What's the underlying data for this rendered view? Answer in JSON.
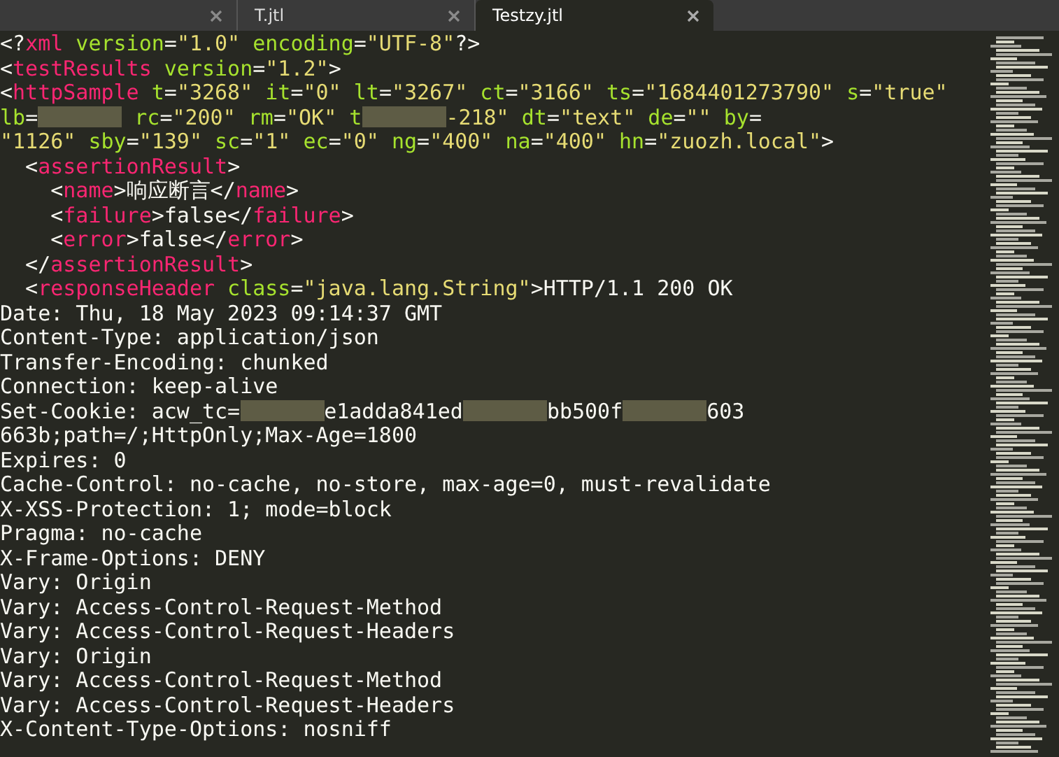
{
  "tabs": [
    {
      "selected": false
    },
    {
      "label": "T.jtl",
      "selected": false
    },
    {
      "label": "Testzy.jtl",
      "selected": true
    }
  ],
  "editor": {
    "lines": [
      [
        {
          "kind": "punct",
          "text": "<?"
        },
        {
          "kind": "tag",
          "text": "xml"
        },
        {
          "kind": "attr",
          "text": " version"
        },
        {
          "kind": "punct",
          "text": "="
        },
        {
          "kind": "string",
          "text": "\"1.0\""
        },
        {
          "kind": "attr",
          "text": " encoding"
        },
        {
          "kind": "punct",
          "text": "="
        },
        {
          "kind": "string",
          "text": "\"UTF-8\""
        },
        {
          "kind": "punct",
          "text": "?>"
        }
      ],
      [
        {
          "kind": "punct",
          "text": "<"
        },
        {
          "kind": "tag",
          "text": "testResults"
        },
        {
          "kind": "attr",
          "text": " version"
        },
        {
          "kind": "punct",
          "text": "="
        },
        {
          "kind": "string",
          "text": "\"1.2\""
        },
        {
          "kind": "punct",
          "text": ">"
        }
      ],
      [
        {
          "kind": "punct",
          "text": "<"
        },
        {
          "kind": "tag",
          "text": "httpSample"
        },
        {
          "kind": "attr",
          "text": " t"
        },
        {
          "kind": "punct",
          "text": "="
        },
        {
          "kind": "string",
          "text": "\"3268\""
        },
        {
          "kind": "attr",
          "text": " it"
        },
        {
          "kind": "punct",
          "text": "="
        },
        {
          "kind": "string",
          "text": "\"0\""
        },
        {
          "kind": "attr",
          "text": " lt"
        },
        {
          "kind": "punct",
          "text": "="
        },
        {
          "kind": "string",
          "text": "\"3267\""
        },
        {
          "kind": "attr",
          "text": " ct"
        },
        {
          "kind": "punct",
          "text": "="
        },
        {
          "kind": "string",
          "text": "\"3166\""
        },
        {
          "kind": "attr",
          "text": " ts"
        },
        {
          "kind": "punct",
          "text": "="
        },
        {
          "kind": "string",
          "text": "\"1684401273790\""
        },
        {
          "kind": "attr",
          "text": " s"
        },
        {
          "kind": "punct",
          "text": "="
        },
        {
          "kind": "string",
          "text": "\"true\""
        }
      ],
      [
        {
          "kind": "attr",
          "text": "lb"
        },
        {
          "kind": "punct",
          "text": "="
        },
        {
          "kind": "redacted"
        },
        {
          "kind": "attr",
          "text": " rc"
        },
        {
          "kind": "punct",
          "text": "="
        },
        {
          "kind": "string",
          "text": "\"200\""
        },
        {
          "kind": "attr",
          "text": " rm"
        },
        {
          "kind": "punct",
          "text": "="
        },
        {
          "kind": "string",
          "text": "\"OK\""
        },
        {
          "kind": "attr",
          "text": " t"
        },
        {
          "kind": "redacted"
        },
        {
          "kind": "string",
          "text": "-218\""
        },
        {
          "kind": "attr",
          "text": " dt"
        },
        {
          "kind": "punct",
          "text": "="
        },
        {
          "kind": "string",
          "text": "\"text\""
        },
        {
          "kind": "attr",
          "text": " de"
        },
        {
          "kind": "punct",
          "text": "="
        },
        {
          "kind": "string",
          "text": "\"\""
        },
        {
          "kind": "attr",
          "text": " by"
        },
        {
          "kind": "punct",
          "text": "="
        }
      ],
      [
        {
          "kind": "string",
          "text": "\"1126\""
        },
        {
          "kind": "attr",
          "text": " sby"
        },
        {
          "kind": "punct",
          "text": "="
        },
        {
          "kind": "string",
          "text": "\"139\""
        },
        {
          "kind": "attr",
          "text": " sc"
        },
        {
          "kind": "punct",
          "text": "="
        },
        {
          "kind": "string",
          "text": "\"1\""
        },
        {
          "kind": "attr",
          "text": " ec"
        },
        {
          "kind": "punct",
          "text": "="
        },
        {
          "kind": "string",
          "text": "\"0\""
        },
        {
          "kind": "attr",
          "text": " ng"
        },
        {
          "kind": "punct",
          "text": "="
        },
        {
          "kind": "string",
          "text": "\"400\""
        },
        {
          "kind": "attr",
          "text": " na"
        },
        {
          "kind": "punct",
          "text": "="
        },
        {
          "kind": "string",
          "text": "\"400\""
        },
        {
          "kind": "attr",
          "text": " hn"
        },
        {
          "kind": "punct",
          "text": "="
        },
        {
          "kind": "string",
          "text": "\"zuozh.local\""
        },
        {
          "kind": "punct",
          "text": ">"
        }
      ],
      [
        {
          "kind": "punct",
          "text": "  <"
        },
        {
          "kind": "tag",
          "text": "assertionResult"
        },
        {
          "kind": "punct",
          "text": ">"
        }
      ],
      [
        {
          "kind": "punct",
          "text": "    <"
        },
        {
          "kind": "tag",
          "text": "name"
        },
        {
          "kind": "punct",
          "text": ">响应断言</"
        },
        {
          "kind": "tag",
          "text": "name"
        },
        {
          "kind": "punct",
          "text": ">"
        }
      ],
      [
        {
          "kind": "punct",
          "text": "    <"
        },
        {
          "kind": "tag",
          "text": "failure"
        },
        {
          "kind": "punct",
          "text": ">false</"
        },
        {
          "kind": "tag",
          "text": "failure"
        },
        {
          "kind": "punct",
          "text": ">"
        }
      ],
      [
        {
          "kind": "punct",
          "text": "    <"
        },
        {
          "kind": "tag",
          "text": "error"
        },
        {
          "kind": "punct",
          "text": ">false</"
        },
        {
          "kind": "tag",
          "text": "error"
        },
        {
          "kind": "punct",
          "text": ">"
        }
      ],
      [
        {
          "kind": "punct",
          "text": "  </"
        },
        {
          "kind": "tag",
          "text": "assertionResult"
        },
        {
          "kind": "punct",
          "text": ">"
        }
      ],
      [
        {
          "kind": "punct",
          "text": "  <"
        },
        {
          "kind": "tag",
          "text": "responseHeader"
        },
        {
          "kind": "attr",
          "text": " class"
        },
        {
          "kind": "punct",
          "text": "="
        },
        {
          "kind": "string",
          "text": "\"java.lang.String\""
        },
        {
          "kind": "punct",
          "text": ">HTTP/1.1 200 OK"
        }
      ],
      [
        {
          "kind": "punct",
          "text": "Date: Thu, 18 May 2023 09:14:37 GMT"
        }
      ],
      [
        {
          "kind": "punct",
          "text": "Content-Type: application/json"
        }
      ],
      [
        {
          "kind": "punct",
          "text": "Transfer-Encoding: chunked"
        }
      ],
      [
        {
          "kind": "punct",
          "text": "Connection: keep-alive"
        }
      ],
      [
        {
          "kind": "punct",
          "text": "Set-Cookie: acw_tc="
        },
        {
          "kind": "redacted"
        },
        {
          "kind": "punct",
          "text": "e1adda841ed"
        },
        {
          "kind": "redacted"
        },
        {
          "kind": "punct",
          "text": "bb500f"
        },
        {
          "kind": "redacted"
        },
        {
          "kind": "punct",
          "text": "603"
        }
      ],
      [
        {
          "kind": "punct",
          "text": "663b;path=/;HttpOnly;Max-Age=1800"
        }
      ],
      [
        {
          "kind": "punct",
          "text": "Expires: 0"
        }
      ],
      [
        {
          "kind": "punct",
          "text": "Cache-Control: no-cache, no-store, max-age=0, must-revalidate"
        }
      ],
      [
        {
          "kind": "punct",
          "text": "X-XSS-Protection: 1; mode=block"
        }
      ],
      [
        {
          "kind": "punct",
          "text": "Pragma: no-cache"
        }
      ],
      [
        {
          "kind": "punct",
          "text": "X-Frame-Options: DENY"
        }
      ],
      [
        {
          "kind": "punct",
          "text": "Vary: Origin"
        }
      ],
      [
        {
          "kind": "punct",
          "text": "Vary: Access-Control-Request-Method"
        }
      ],
      [
        {
          "kind": "punct",
          "text": "Vary: Access-Control-Request-Headers"
        }
      ],
      [
        {
          "kind": "punct",
          "text": "Vary: Origin"
        }
      ],
      [
        {
          "kind": "punct",
          "text": "Vary: Access-Control-Request-Method"
        }
      ],
      [
        {
          "kind": "punct",
          "text": "Vary: Access-Control-Request-Headers"
        }
      ],
      [
        {
          "kind": "punct",
          "text": "X-Content-Type-Options: nosniff"
        }
      ]
    ]
  }
}
